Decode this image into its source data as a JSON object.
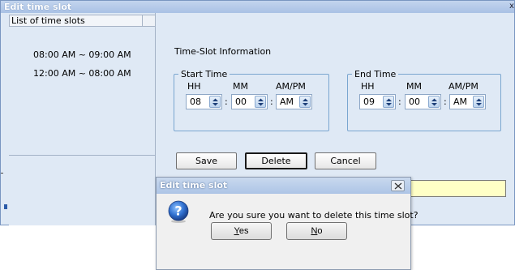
{
  "main_window": {
    "title": "Edit time slot",
    "close_glyph": "x"
  },
  "slot_list": {
    "header": "List of time slots",
    "items": [
      "08:00 AM ~ 09:00 AM",
      "12:00 AM ~ 08:00 AM"
    ]
  },
  "info": {
    "section_label": "Time-Slot Information",
    "start": {
      "legend": "Start Time",
      "labels": [
        "HH",
        "MM",
        "AM/PM"
      ],
      "hh": "08",
      "mm": "00",
      "ampm": "AM"
    },
    "end": {
      "legend": "End Time",
      "labels": [
        "HH",
        "MM",
        "AM/PM"
      ],
      "hh": "09",
      "mm": "00",
      "ampm": "AM"
    },
    "separator": ":"
  },
  "actions": {
    "save": "Save",
    "delete": "Delete",
    "cancel": "Cancel"
  },
  "dialog": {
    "title": "Edit time slot",
    "message": "Are you sure you want to delete this time slot?",
    "yes_accel": "Y",
    "yes_rest": "es",
    "no_accel": "N",
    "no_rest": "o",
    "icon": "question-icon"
  },
  "colors": {
    "window_bg": "#dfe9f5",
    "title_bar": "#adc5e6",
    "highlight_field": "#ffffc6",
    "group_border": "#7aa6d0"
  }
}
